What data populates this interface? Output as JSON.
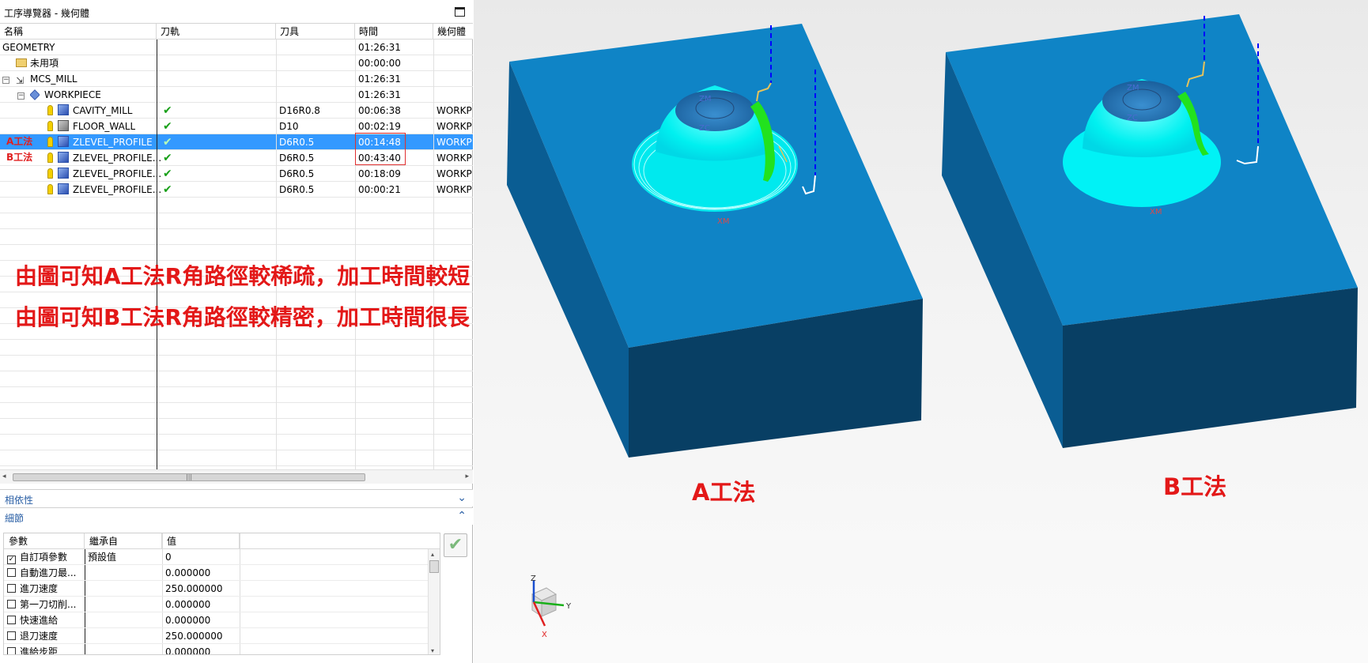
{
  "navigator": {
    "title": "工序導覽器 - 幾何體",
    "columns": {
      "name": "名稱",
      "toolpath": "刀軌",
      "tool": "刀具",
      "time": "時間",
      "geometry": "幾何體"
    },
    "rows": [
      {
        "name": "GEOMETRY",
        "check": "",
        "tool": "",
        "time": "01:26:31",
        "geom": ""
      },
      {
        "name": "未用項",
        "check": "",
        "tool": "",
        "time": "00:00:00",
        "geom": ""
      },
      {
        "name": "MCS_MILL",
        "check": "",
        "tool": "",
        "time": "01:26:31",
        "geom": ""
      },
      {
        "name": "WORKPIECE",
        "check": "",
        "tool": "",
        "time": "01:26:31",
        "geom": ""
      },
      {
        "name": "CAVITY_MILL",
        "check": "✔",
        "tool": "D16R0.8",
        "time": "00:06:38",
        "geom": "WORKP"
      },
      {
        "name": "FLOOR_WALL",
        "check": "✔",
        "tool": "D10",
        "time": "00:02:19",
        "geom": "WORKP"
      },
      {
        "name": "ZLEVEL_PROFILE",
        "check": "✔",
        "tool": "D6R0.5",
        "time": "00:14:48",
        "geom": "WORKP"
      },
      {
        "name": "ZLEVEL_PROFILE...",
        "check": "✔",
        "tool": "D6R0.5",
        "time": "00:43:40",
        "geom": "WORKP"
      },
      {
        "name": "ZLEVEL_PROFILE...",
        "check": "✔",
        "tool": "D6R0.5",
        "time": "00:18:09",
        "geom": "WORKP"
      },
      {
        "name": "ZLEVEL_PROFILE...",
        "check": "✔",
        "tool": "D6R0.5",
        "time": "00:00:21",
        "geom": "WORKP"
      }
    ],
    "selected_row": 6,
    "tags": {
      "a": "A工法",
      "b": "B工法"
    },
    "scroll_grip": "|||",
    "scroll_left": "◂",
    "scroll_right": "▸"
  },
  "sections": {
    "dependencies": "相依性",
    "details": "細節",
    "dependencies_chevron": "⌄",
    "details_chevron": "⌃"
  },
  "details": {
    "columns": {
      "param": "參數",
      "inherit": "繼承自",
      "value": "值"
    },
    "rows": [
      {
        "checked": true,
        "param": "自訂項參數",
        "inherit": "預設值",
        "value": "0"
      },
      {
        "checked": false,
        "param": "自動進刀最...",
        "inherit": "",
        "value": "0.000000"
      },
      {
        "checked": false,
        "param": "進刀速度",
        "inherit": "",
        "value": "250.000000"
      },
      {
        "checked": false,
        "param": "第一刀切削...",
        "inherit": "",
        "value": "0.000000"
      },
      {
        "checked": false,
        "param": "快速進給",
        "inherit": "",
        "value": "0.000000"
      },
      {
        "checked": false,
        "param": "退刀速度",
        "inherit": "",
        "value": "250.000000"
      },
      {
        "checked": false,
        "param": "進給步距",
        "inherit": "",
        "value": "0.000000"
      }
    ],
    "ok_symbol": "✔",
    "scroll_up": "▴",
    "scroll_down": "▾"
  },
  "annotations": {
    "line1": "由圖可知A工法R角路徑較稀疏，加工時間較短",
    "line2": "由圖可知B工法R角路徑較精密，加工時間很長"
  },
  "viewport": {
    "label_a": "A工法",
    "label_b": "B工法",
    "model_a_axis": {
      "zm": "ZM",
      "zc": "ZC",
      "xm": "XM"
    },
    "model_b_axis": {
      "zm": "ZM",
      "zc": "ZC",
      "xm": "XM"
    },
    "triad": {
      "z": "Z",
      "y": "Y",
      "x": "X"
    },
    "colors": {
      "block_top": "#0f7fc4",
      "block_left": "#0a5a8e",
      "block_front": "#083f63",
      "surface": "#00ffff",
      "toolpath": "#0000ff",
      "highlight": "#00e000"
    }
  }
}
